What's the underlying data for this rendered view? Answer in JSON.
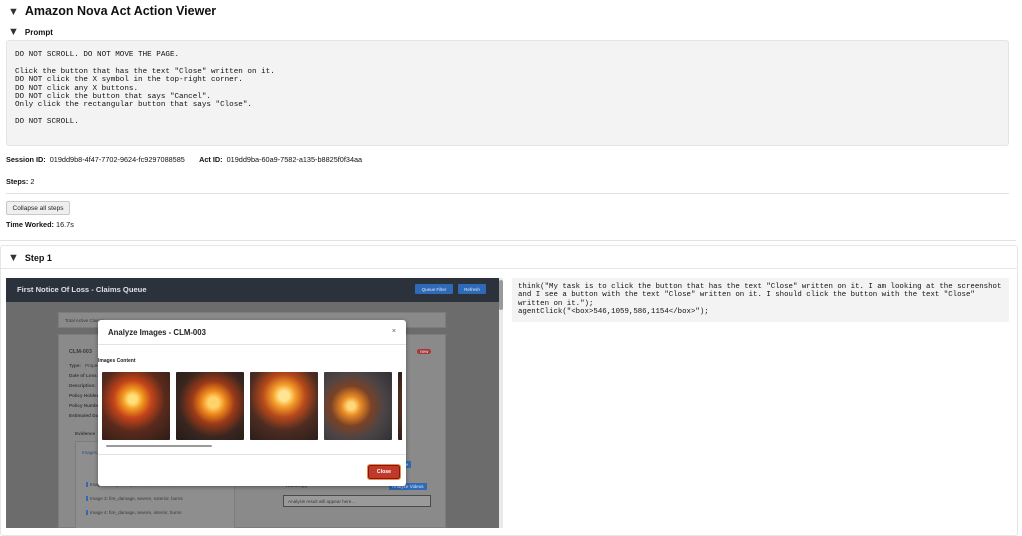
{
  "viewer": {
    "title": "Amazon Nova Act Action Viewer",
    "prompt_heading": "Prompt",
    "prompt_text": "DO NOT SCROLL. DO NOT MOVE THE PAGE.\n\nClick the button that has the text \"Close\" written on it.\nDO NOT click the X symbol in the top-right corner.\nDO NOT click any X buttons.\nDO NOT click the button that says \"Cancel\".\nOnly click the rectangular button that says \"Close\".\n\nDO NOT SCROLL.",
    "session_label": "Session ID:",
    "session_id": "019dd9b8-4f47-7702-9624-fc9297088585",
    "act_label": "Act ID:",
    "act_id": "019dd9ba-60a9-7582-a135-b8825f0f34aa",
    "steps_label": "Steps:",
    "steps_value": "2",
    "collapse_label": "Collapse all steps",
    "time_label": "Time Worked:",
    "time_value": "16.7s"
  },
  "step": {
    "heading": "Step 1",
    "thought": "think(\"My task is to click the button that has the text \"Close\" written on it. I am looking at the screenshot and I see a button with the text \"Close\" written on it. I should click the button with the text \"Close\" written on it.\");\nagentClick(\"<box>546,1059,586,1154</box>\");"
  },
  "screenshot": {
    "app_title": "First Notice Of Loss - Claims Queue",
    "queue_btn": "Queue Filter",
    "refresh_btn": "Refresh",
    "total_active": "Total Active Claims",
    "claim_id": "CLM-003",
    "badge": "new",
    "fields": [
      "Type:",
      "Date of Loss:",
      "Description:",
      "Policy Holder:",
      "Policy Number:",
      "Estimated Damage:"
    ],
    "field_value_type": "Property",
    "evidence_label": "Evidence",
    "images_tab": "Images",
    "image_rows": [
      "Image 2:   fire_damage, severe, kitchen, burns",
      "Image 3:   fire_damage, severe, exterior, burns",
      "Image 4:   fire_damage, severe, interior, burns"
    ],
    "videos_label": "Videos (2)",
    "analyze_videos_btn": "Analyze Videos",
    "analysis_placeholder": "Analysis result will appear here...",
    "analyze_btn_small": "Analyze",
    "modal": {
      "title": "Analyze Images - CLM-003",
      "close_x": "×",
      "images_label": "Images Content",
      "close_button": "Close"
    }
  },
  "colors": {
    "accent": "#2f6ab7",
    "close_button": "#c0392b",
    "app_header": "#2b323c"
  }
}
